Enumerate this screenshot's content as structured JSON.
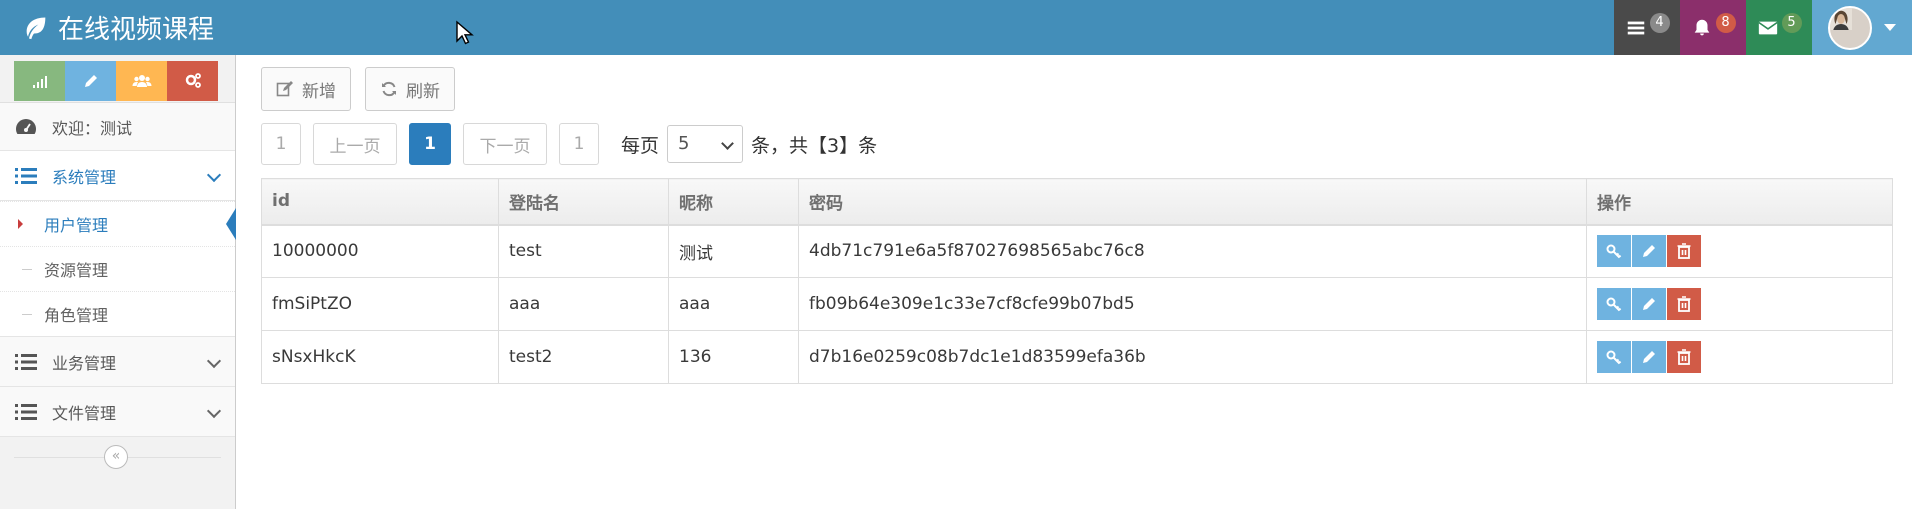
{
  "header": {
    "title": "在线视频课程",
    "tasks_count": "4",
    "notifications_count": "8",
    "messages_count": "5"
  },
  "sidebar": {
    "welcome": "欢迎：测试",
    "menus": [
      {
        "label": "系统管理",
        "expanded": true,
        "items": [
          {
            "label": "用户管理",
            "active": true
          },
          {
            "label": "资源管理"
          },
          {
            "label": "角色管理"
          }
        ]
      },
      {
        "label": "业务管理",
        "expanded": false
      },
      {
        "label": "文件管理",
        "expanded": false
      }
    ],
    "collapse_glyph": "«"
  },
  "toolbar": {
    "add_label": "新增",
    "refresh_label": "刷新"
  },
  "pager": {
    "first": "1",
    "prev": "上一页",
    "current": "1",
    "next": "下一页",
    "last": "1",
    "per_page_prefix": "每页",
    "per_page_value": "5",
    "summary": "条，共【3】条"
  },
  "table": {
    "columns": [
      "id",
      "登陆名",
      "昵称",
      "密码",
      "操作"
    ],
    "rows": [
      {
        "id": "10000000",
        "login": "test",
        "nickname": "测试",
        "password": "4db71c791e6a5f87027698565abc76c8"
      },
      {
        "id": "fmSiPtZO",
        "login": "aaa",
        "nickname": "aaa",
        "password": "fb09b64e309e1c33e7cf8cfe99b07bd5"
      },
      {
        "id": "sNsxHkcK",
        "login": "test2",
        "nickname": "136",
        "password": "d7b16e0259c08b7dc1e1d83599efa36b"
      }
    ]
  },
  "colors": {
    "navbar": "#438eb9",
    "primary": "#2b7dbc",
    "danger": "#d15b47",
    "info": "#6fb3e0"
  }
}
